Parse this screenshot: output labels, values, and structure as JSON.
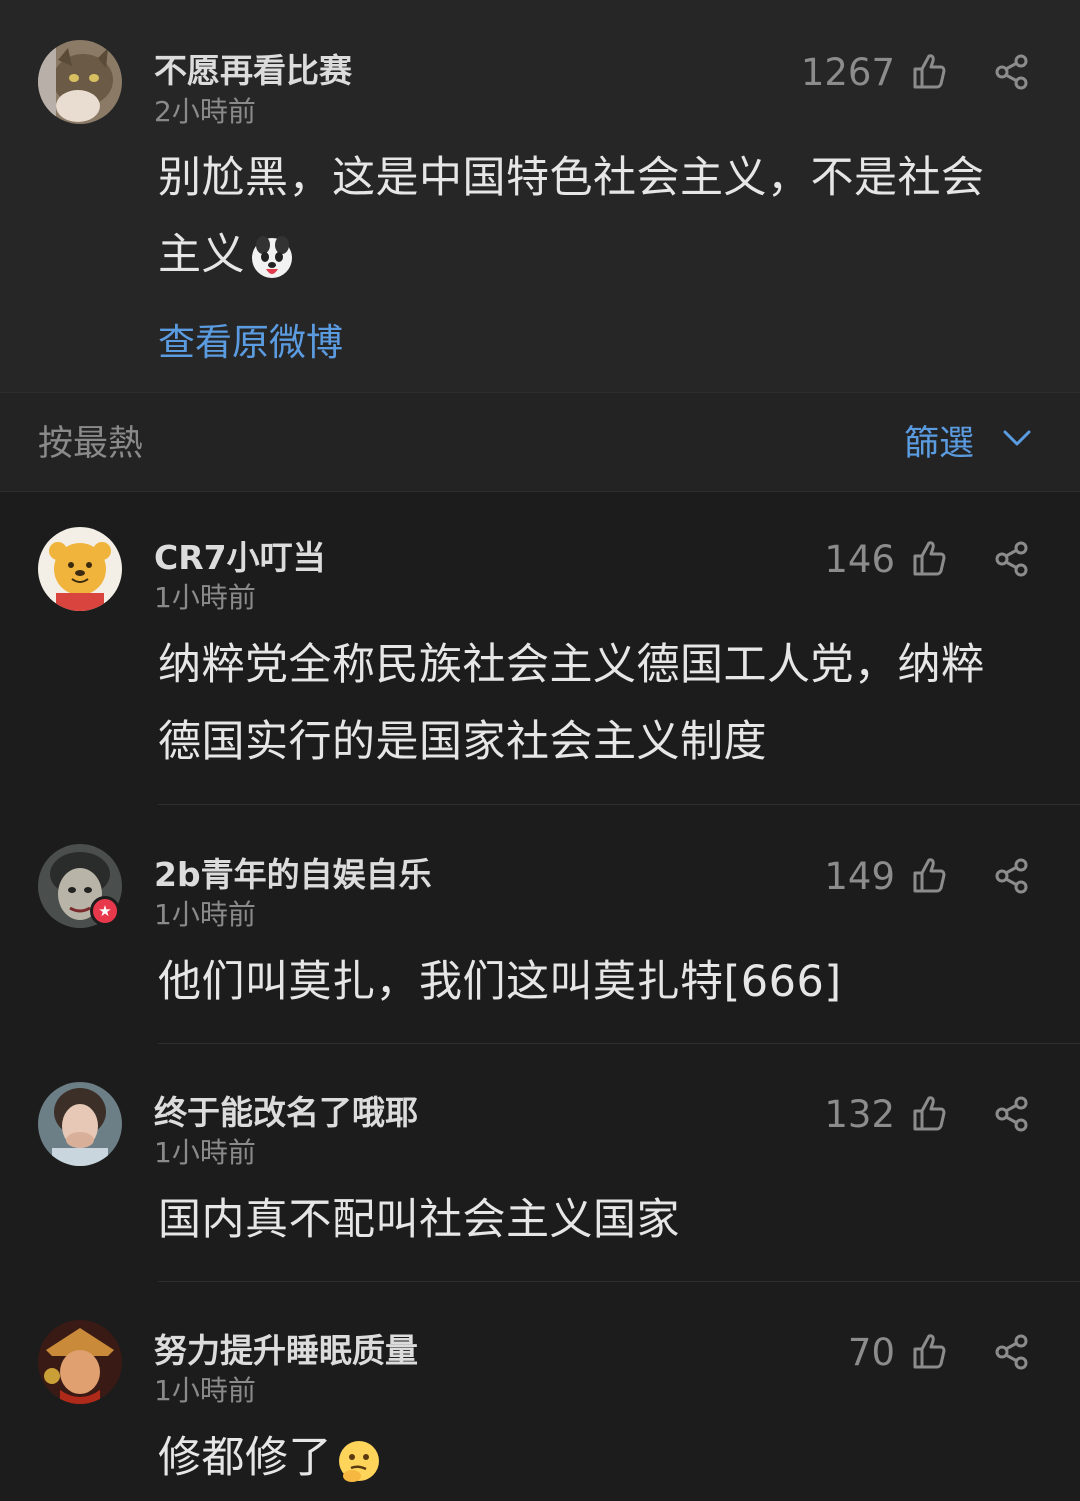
{
  "top_comment": {
    "username": "不愿再看比赛",
    "time": "2小時前",
    "likes": "1267",
    "text_line1": "别尬黑，这是中国特色社会主义，不是社会",
    "text_line2": "主义",
    "emoji_icon": "dog-emoji-icon",
    "link_label": "查看原微博"
  },
  "sort_bar": {
    "sort_label": "按最熱",
    "filter_label": "篩選"
  },
  "comments": [
    {
      "username": "CR7小叮当",
      "time": "1小時前",
      "likes": "146",
      "text_line1": "纳粹党全称民族社会主义德国工人党，纳粹",
      "text_line2": "德国实行的是国家社会主义制度"
    },
    {
      "username": "2b青年的自娱自乐",
      "time": "1小時前",
      "likes": "149",
      "text_line1": "他们叫莫扎，我们这叫莫扎特[666]",
      "verified_icon": "verified-star-badge-icon"
    },
    {
      "username": "终于能改名了哦耶",
      "time": "1小時前",
      "likes": "132",
      "text_line1": "国内真不配叫社会主义国家"
    },
    {
      "username": "努力提升睡眠质量",
      "time": "1小時前",
      "likes": "70",
      "text_line1": "修都修了",
      "emoji_icon": "thinking-face-emoji-icon"
    }
  ],
  "colors": {
    "background": "#1c1c1d",
    "top_background": "#262627",
    "link_blue": "#5b9be0",
    "verified_red": "#e8394c"
  }
}
